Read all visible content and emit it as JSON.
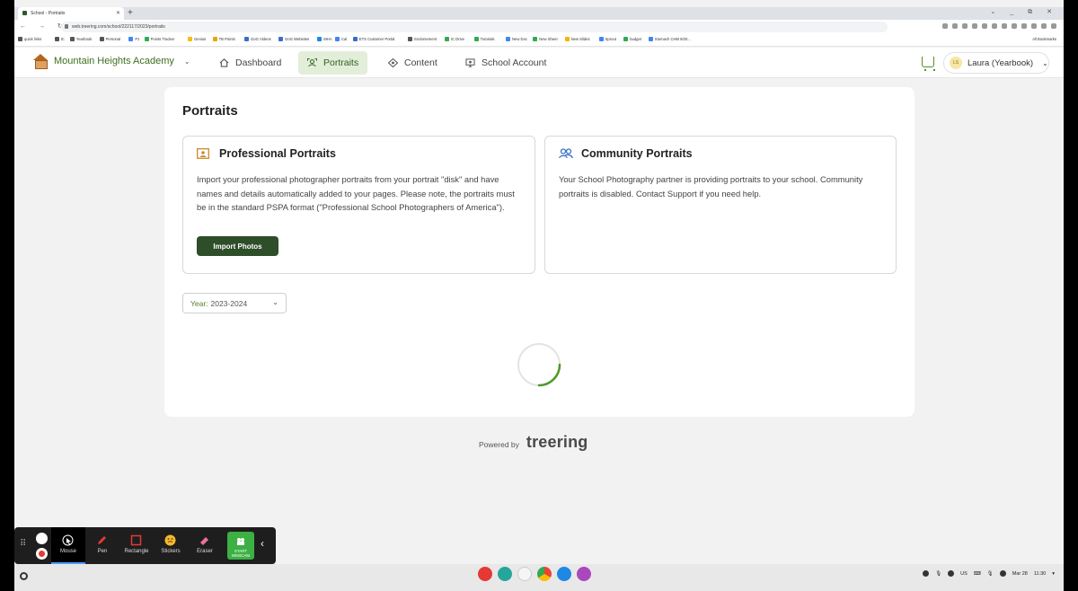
{
  "browser": {
    "tab_title": "School - Portraits",
    "url": "web.treering.com/school/222117/2023/portraits",
    "bookmarks": [
      "quick links",
      "IC",
      "Yearbook",
      "Personal",
      "PJ",
      "Points Tracker",
      "Genius",
      "TB Points",
      "GoG Videos",
      "GoG Websites",
      "MHA",
      "Cal",
      "ETS Customer Portal",
      "Endorsement",
      "IC Drive",
      "Tutorials",
      "New Doc",
      "New Sheet",
      "New Slides",
      "Sprout",
      "budget",
      "Stomach CHM 9/20..."
    ],
    "all_bookmarks": "All Bookmarks"
  },
  "header": {
    "school_name": "Mountain Heights Academy",
    "nav": [
      {
        "label": "Dashboard"
      },
      {
        "label": "Portraits"
      },
      {
        "label": "Content"
      },
      {
        "label": "School Account"
      }
    ],
    "user": {
      "initials": "LS",
      "name": "Laura (Yearbook)"
    }
  },
  "page": {
    "title": "Portraits",
    "professional": {
      "title": "Professional Portraits",
      "description": "Import your professional photographer portraits from your portrait \"disk\" and have names and details automatically added to your pages. Please note, the portraits must be in the standard PSPA format (\"Professional School Photographers of America\").",
      "button": "Import Photos"
    },
    "community": {
      "title": "Community Portraits",
      "description": "Your School Photography partner is providing portraits to your school. Community portraits is disabled. Contact Support if you need help."
    },
    "year": {
      "label": "Year:",
      "value": "2023-2024"
    },
    "powered_by": "Powered by",
    "brand": "treering"
  },
  "recorder": {
    "tools": [
      "Mouse",
      "Pen",
      "Rectangle",
      "Stickers",
      "Eraser"
    ],
    "webcam": "START WEBCAM"
  },
  "shelf": {
    "locale": "US",
    "date": "Mar 28",
    "time": "11:30"
  },
  "colors": {
    "brand_green": "#2e4d29",
    "nav_active_bg": "#e2eed9",
    "accent": "#3d6f1e"
  }
}
